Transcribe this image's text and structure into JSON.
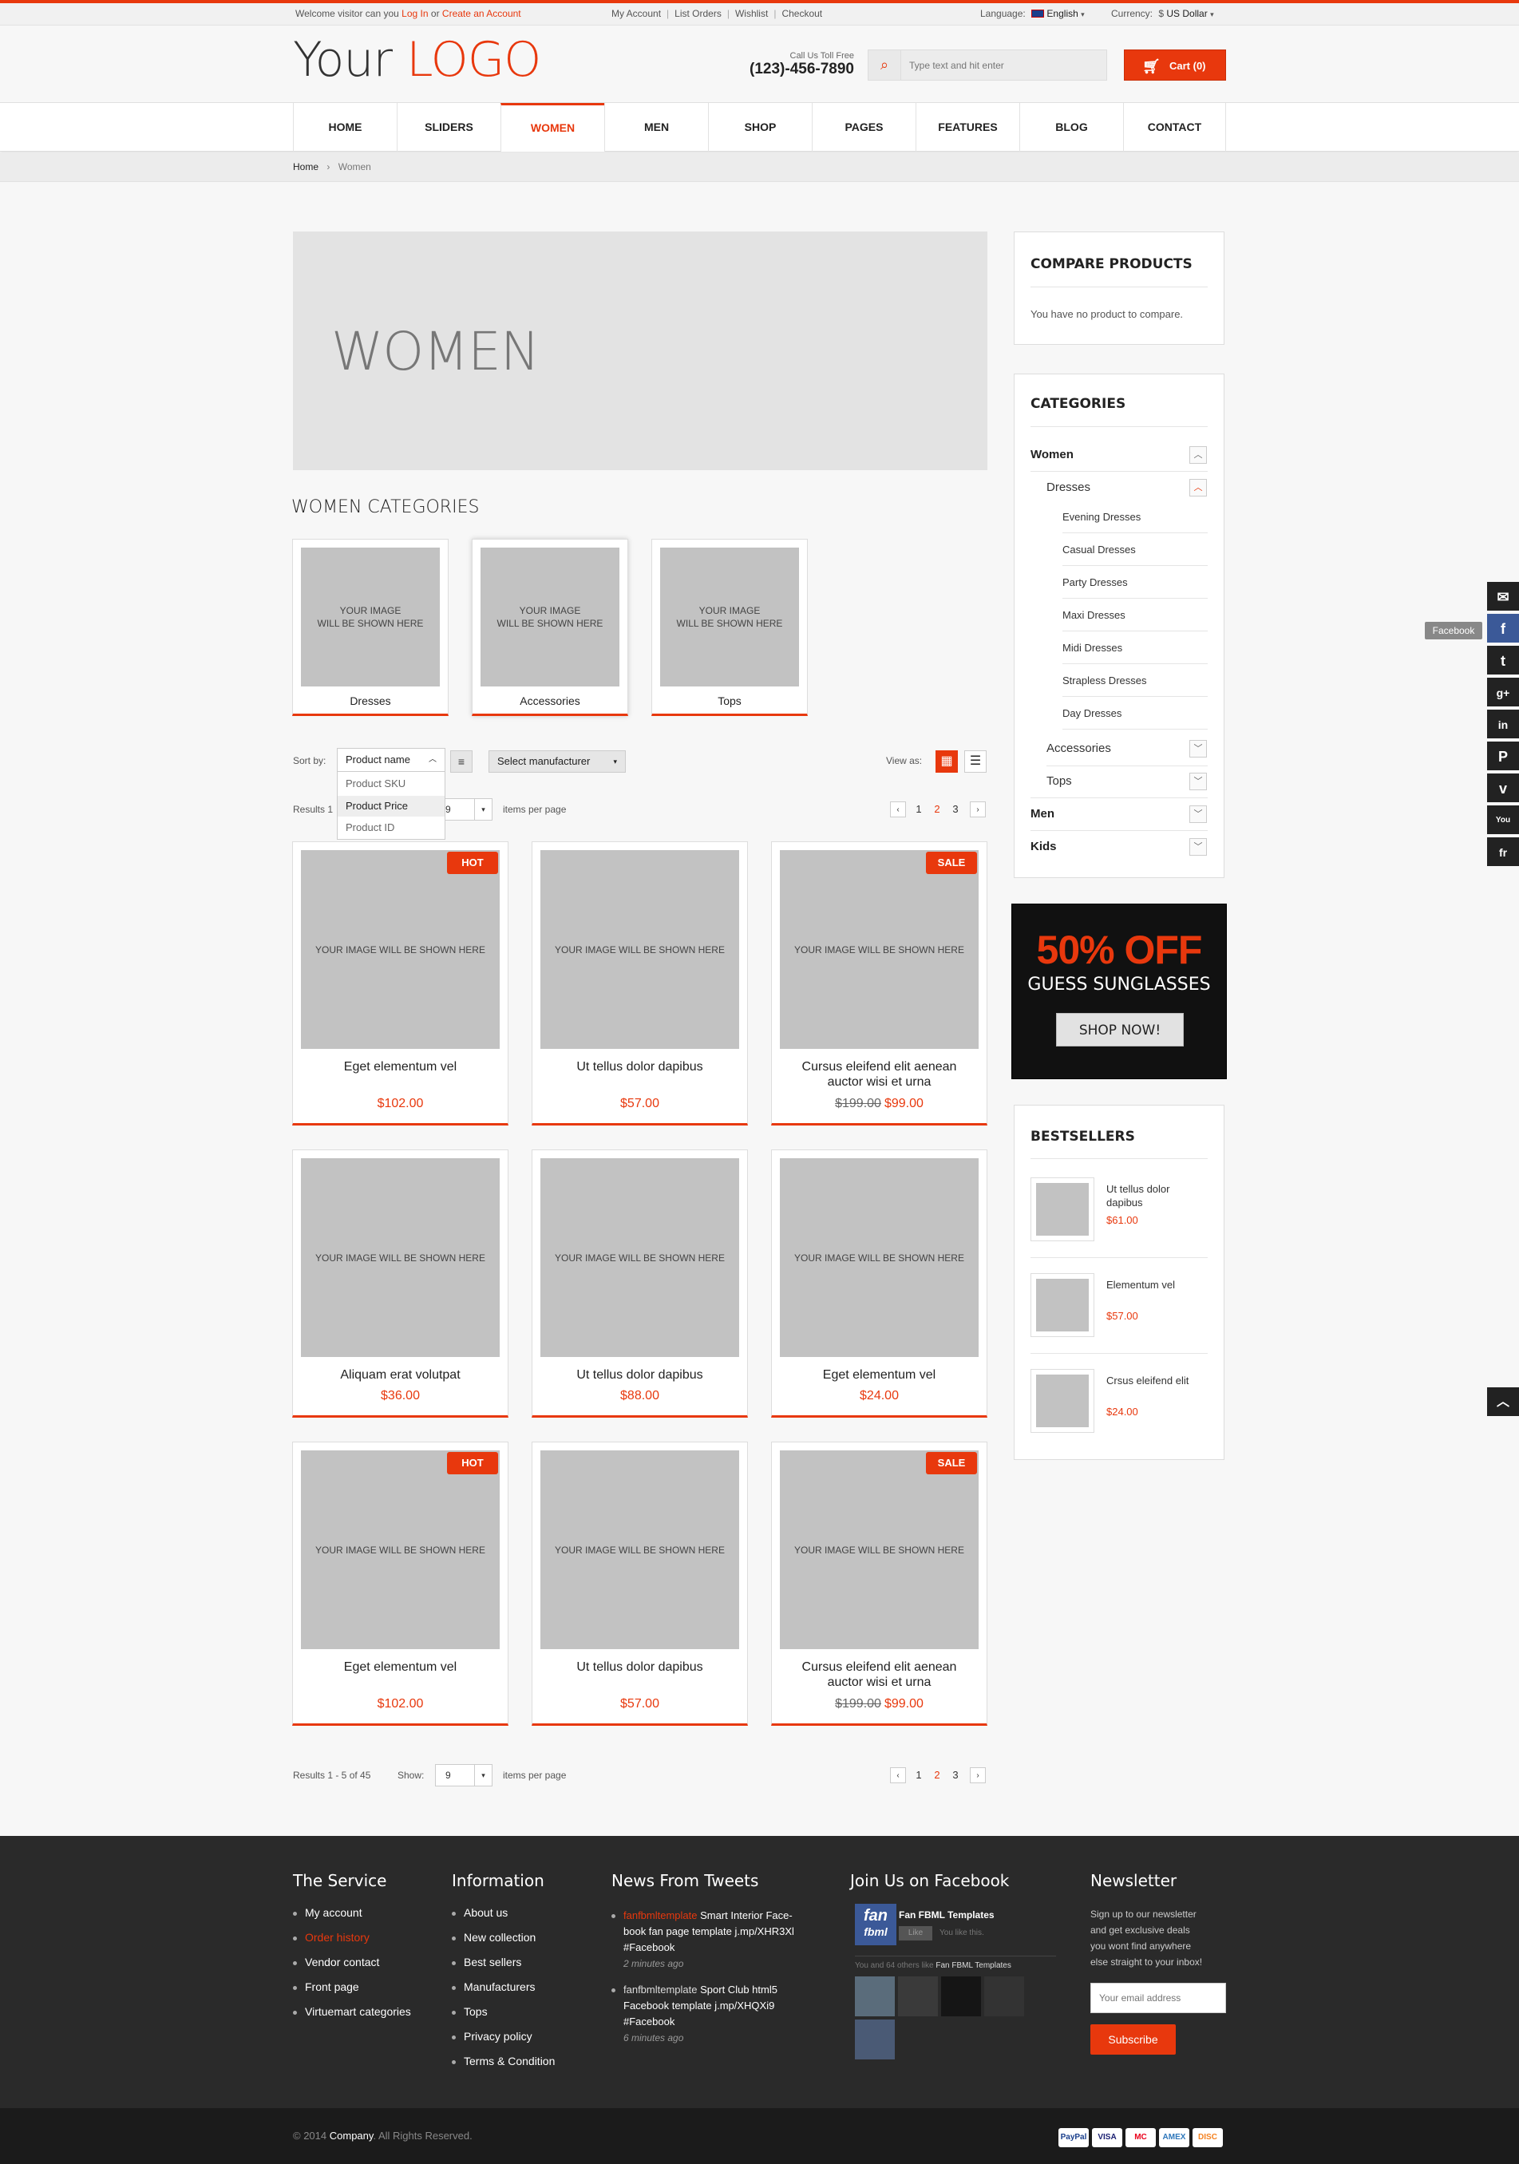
{
  "topbar": {
    "welcome_pre": "Welcome visitor can you",
    "login": "Log In",
    "or": "or",
    "create": "Create an Account",
    "links": [
      "My Account",
      "List Orders",
      "Wishlist",
      "Checkout"
    ],
    "language_label": "Language:",
    "language_value": "English",
    "currency_label": "Currency:",
    "currency_value": "$ US Dollar"
  },
  "header": {
    "logo_a": "Your",
    "logo_b": "LOGO",
    "call_label": "Call Us Toll Free",
    "phone": "(123)-456-7890",
    "search_placeholder": "Type text and hit enter",
    "cart": "Cart (0)"
  },
  "nav": {
    "items": [
      "HOME",
      "SLIDERS",
      "WOMEN",
      "MEN",
      "SHOP",
      "PAGES",
      "FEATURES",
      "BLOG",
      "CONTACT"
    ],
    "active": "WOMEN"
  },
  "breadcrumb": {
    "home": "Home",
    "sep": "›",
    "current": "Women"
  },
  "banner": {
    "title": "WOMEN"
  },
  "categories": {
    "title": "WOMEN CATEGORIES",
    "placeholder_line1": "YOUR IMAGE",
    "placeholder_line2": "WILL BE SHOWN HERE",
    "items": [
      "Dresses",
      "Accessories",
      "Tops"
    ]
  },
  "toolbar": {
    "sort_label": "Sort by:",
    "sort_value": "Product name",
    "sort_options": [
      "Product SKU",
      "Product Price",
      "Product ID"
    ],
    "manufacturer": "Select manufacturer",
    "view_label": "View as:",
    "results_top_prefix": "Results 1",
    "show_value_top": "9",
    "items_per_page": "items per page",
    "results_bottom": "Results 1 - 5 of 45",
    "show_label": "Show:",
    "show_value": "9",
    "pages": [
      "1",
      "2",
      "3"
    ],
    "prev": "‹",
    "next": "›"
  },
  "products": {
    "placeholder": "YOUR IMAGE WILL BE SHOWN HERE",
    "items": [
      {
        "name": "Eget elementum vel",
        "price": "$102.00",
        "old": "",
        "badge": "HOT"
      },
      {
        "name": "Ut tellus dolor dapibus",
        "price": "$57.00",
        "old": "",
        "badge": ""
      },
      {
        "name": "Cursus eleifend elit aenean auctor wisi et urna",
        "price": "$99.00",
        "old": "$199.00",
        "badge": "SALE"
      },
      {
        "name": "Aliquam erat volutpat",
        "price": "$36.00",
        "old": "",
        "badge": ""
      },
      {
        "name": "Ut tellus dolor dapibus",
        "price": "$88.00",
        "old": "",
        "badge": ""
      },
      {
        "name": "Eget elementum vel",
        "price": "$24.00",
        "old": "",
        "badge": ""
      },
      {
        "name": "Eget elementum vel",
        "price": "$102.00",
        "old": "",
        "badge": "HOT"
      },
      {
        "name": "Ut tellus dolor dapibus",
        "price": "$57.00",
        "old": "",
        "badge": ""
      },
      {
        "name": "Cursus eleifend elit aenean auctor wisi et urna",
        "price": "$99.00",
        "old": "$199.00",
        "badge": "SALE"
      }
    ]
  },
  "sidebar": {
    "compare_title": "COMPARE PRODUCTS",
    "compare_text": "You have no product to compare.",
    "categories_title": "CATEGORIES",
    "tree": {
      "women": "Women",
      "dresses": "Dresses",
      "dress_items": [
        "Evening Dresses",
        "Casual Dresses",
        "Party Dresses",
        "Maxi Dresses",
        "Midi Dresses",
        "Strapless Dresses",
        "Day Dresses"
      ],
      "accessories": "Accessories",
      "tops": "Tops",
      "men": "Men",
      "kids": "Kids"
    },
    "promo": {
      "headline": "50% OFF",
      "sub": "GUESS SUNGLASSES",
      "button": "SHOP NOW!"
    },
    "bestsellers_title": "BESTSELLERS",
    "bestsellers": [
      {
        "name": "Ut tellus dolor dapibus",
        "price": "$61.00"
      },
      {
        "name": "Elementum vel",
        "price": "$57.00"
      },
      {
        "name": "Crsus eleifend elit",
        "price": "$24.00"
      }
    ]
  },
  "social": {
    "tooltip": "Facebook",
    "icons": [
      "✉",
      "f",
      "t",
      "g+",
      "in",
      "P",
      "v",
      "You",
      "fr"
    ],
    "top_arrow": "︿"
  },
  "footer": {
    "service_title": "The Service",
    "service_links": [
      "My account",
      "Order history",
      "Vendor contact",
      "Front page",
      "Virtuemart categories"
    ],
    "info_title": "Information",
    "info_links": [
      "About us",
      "New collection",
      "Best sellers",
      "Manufacturers",
      "Tops",
      "Privacy policy",
      "Terms & Condition"
    ],
    "tweets_title": "News From Tweets",
    "tweets": [
      {
        "user": "fanfbmltemplate",
        "l1": "Smart Interior Face-",
        "l2": "book fan page template",
        "link": "j.mp/XHR3Xl",
        "tag": "#Facebook",
        "time": "2 minutes ago"
      },
      {
        "user": "fanfbmltemplate",
        "l1": "Sport Club html5",
        "l2": "Facebook template",
        "link": "j.mp/XHQXi9",
        "tag": "#Facebook",
        "time": "6 minutes ago"
      }
    ],
    "fb_title": "Join Us on Facebook",
    "fb_page": "Fan FBML Templates",
    "fb_like": "Like",
    "fb_you": "You like this.",
    "fb_others": "You and 64 others like",
    "fb_others_page": "Fan FBML Templates",
    "fb_logo_1": "fan",
    "fb_logo_2": "fbml",
    "newsletter_title": "Newsletter",
    "newsletter_text": [
      "Sign up to our newsletter",
      "and get exclusive deals",
      "you wont find anywhere",
      "else straight to your inbox!"
    ],
    "email_placeholder": "Your email address",
    "subscribe": "Subscribe"
  },
  "copyright": {
    "pre": "© 2014",
    "company": "Company",
    "post": ". All Rights Reserved."
  },
  "payments": [
    "PayPal",
    "VISA",
    "MC",
    "AMEX",
    "DISC"
  ],
  "colors": {
    "accent": "#e8380d",
    "footer": "#2a2a2a",
    "placeholder": "#c2c2c2"
  }
}
